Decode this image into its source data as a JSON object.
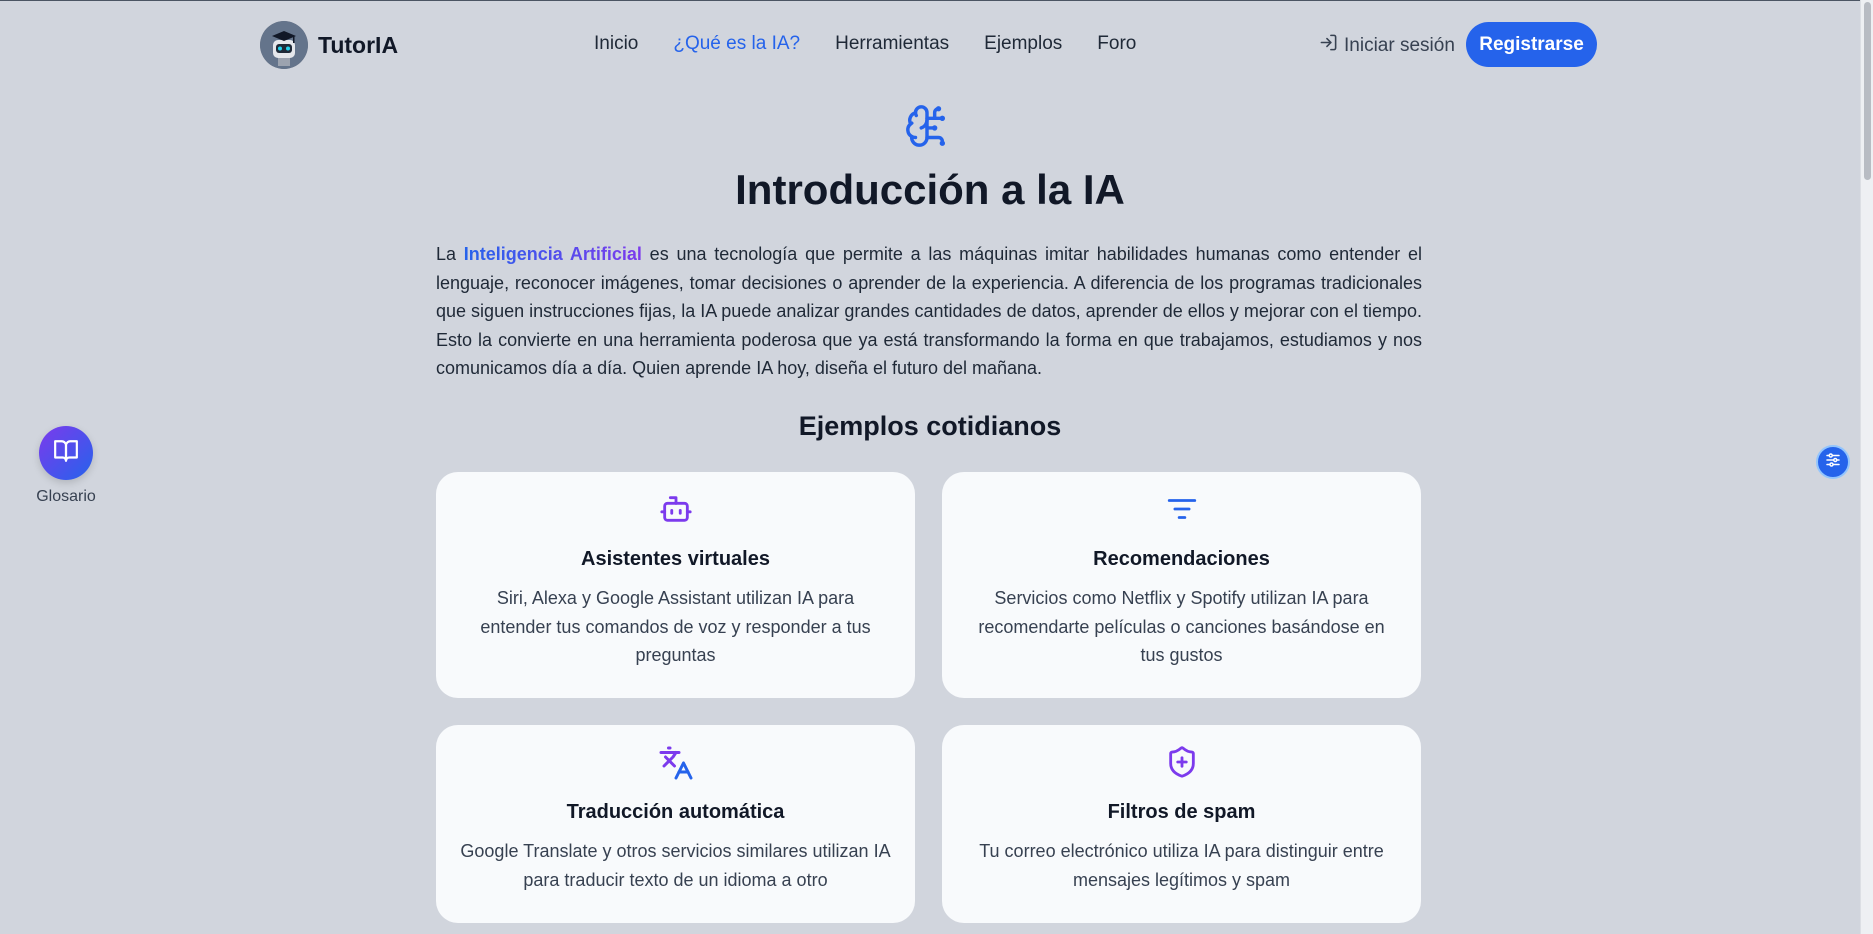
{
  "header": {
    "brand": "TutorIA",
    "nav": [
      {
        "label": "Inicio",
        "active": false
      },
      {
        "label": "¿Qué es la IA?",
        "active": true
      },
      {
        "label": "Herramientas",
        "active": false
      },
      {
        "label": "Ejemplos",
        "active": false
      },
      {
        "label": "Foro",
        "active": false
      }
    ],
    "login_label": "Iniciar sesión",
    "register_label": "Registrarse"
  },
  "main": {
    "title": "Introducción a la IA",
    "intro_prefix": "La ",
    "intro_highlight": "Inteligencia Artificial",
    "intro_rest": " es una tecnología que permite a las máquinas imitar habilidades humanas como entender el lenguaje, reconocer imágenes, tomar decisiones o aprender de la experiencia. A diferencia de los programas tradicionales que siguen instrucciones fijas, la IA puede analizar grandes cantidades de datos, aprender de ellos y mejorar con el tiempo. Esto la convierte en una herramienta poderosa que ya está transformando la forma en que trabajamos, estudiamos y nos comunicamos día a día. Quien aprende IA hoy, diseña el futuro del mañana.",
    "section_title": "Ejemplos cotidianos",
    "cards": [
      {
        "icon": "robot-icon",
        "title": "Asistentes virtuales",
        "text": "Siri, Alexa y Google Assistant utilizan IA para entender tus comandos de voz y responder a tus preguntas"
      },
      {
        "icon": "filter-icon",
        "title": "Recomendaciones",
        "text": "Servicios como Netflix y Spotify utilizan IA para recomendarte películas o canciones basándose en tus gustos"
      },
      {
        "icon": "translate-icon",
        "title": "Traducción automática",
        "text": "Google Translate y otros servicios similares utilizan IA para traducir texto de un idioma a otro"
      },
      {
        "icon": "shield-plus-icon",
        "title": "Filtros de spam",
        "text": "Tu correo electrónico utiliza IA para distinguir entre mensajes legítimos y spam"
      }
    ]
  },
  "glossary": {
    "label": "Glosario"
  },
  "colors": {
    "accent": "#2563eb",
    "purple": "#7c3aed",
    "background": "#d1d5dd",
    "card": "#f8fafc"
  }
}
